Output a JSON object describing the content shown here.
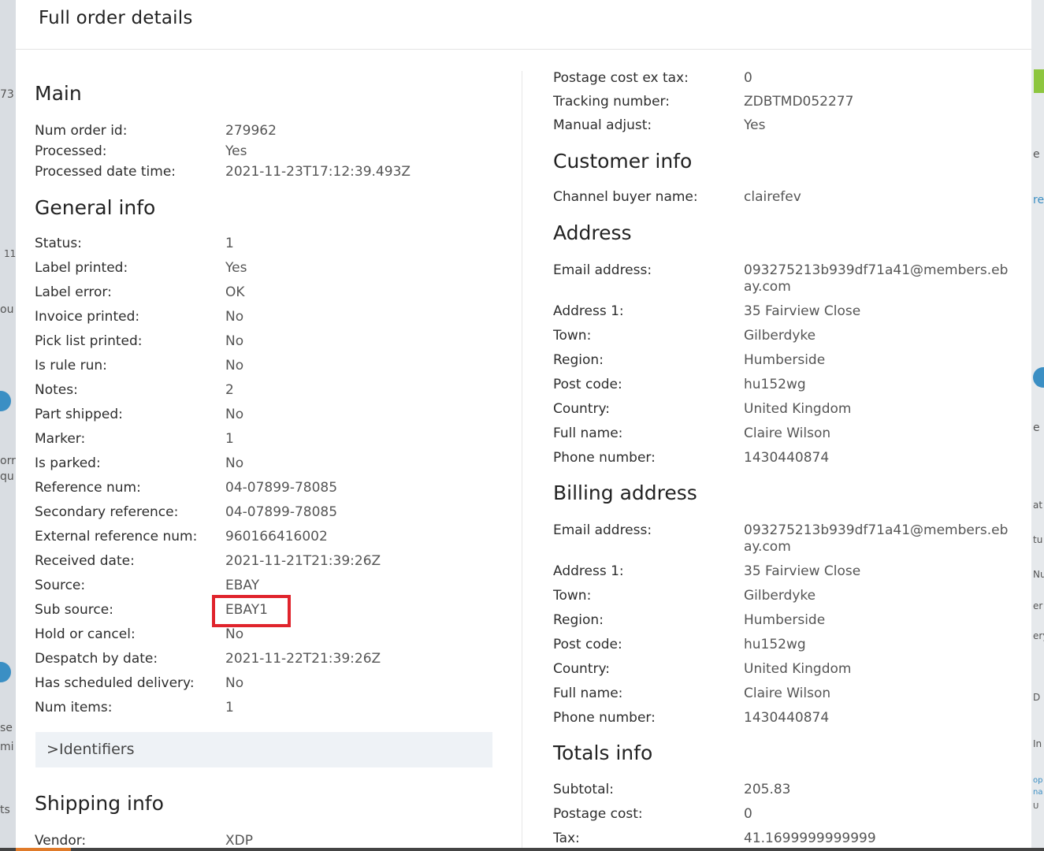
{
  "modal": {
    "title": "Full order details"
  },
  "left": {
    "main": {
      "heading": "Main",
      "rows": [
        {
          "label": "Num order id:",
          "value": "279962"
        },
        {
          "label": "Processed:",
          "value": "Yes"
        },
        {
          "label": "Processed date time:",
          "value": "2021-11-23T17:12:39.493Z"
        }
      ]
    },
    "general": {
      "heading": "General info",
      "rows": [
        {
          "label": "Status:",
          "value": "1"
        },
        {
          "label": "Label printed:",
          "value": "Yes"
        },
        {
          "label": "Label error:",
          "value": "OK"
        },
        {
          "label": "Invoice printed:",
          "value": "No"
        },
        {
          "label": "Pick list printed:",
          "value": "No"
        },
        {
          "label": "Is rule run:",
          "value": "No"
        },
        {
          "label": "Notes:",
          "value": "2"
        },
        {
          "label": "Part shipped:",
          "value": "No"
        },
        {
          "label": "Marker:",
          "value": "1"
        },
        {
          "label": "Is parked:",
          "value": "No"
        },
        {
          "label": "Reference num:",
          "value": "04-07899-78085"
        },
        {
          "label": "Secondary reference:",
          "value": "04-07899-78085"
        },
        {
          "label": "External reference num:",
          "value": "960166416002"
        },
        {
          "label": "Received date:",
          "value": "2021-11-21T21:39:26Z"
        },
        {
          "label": "Source:",
          "value": "EBAY"
        },
        {
          "label": "Sub source:",
          "value": "EBAY1"
        },
        {
          "label": "Hold or cancel:",
          "value": "No"
        },
        {
          "label": "Despatch by date:",
          "value": "2021-11-22T21:39:26Z"
        },
        {
          "label": "Has scheduled delivery:",
          "value": "No"
        },
        {
          "label": "Num items:",
          "value": "1"
        }
      ]
    },
    "identifiers": {
      "chevron": ">",
      "label": "Identifiers"
    },
    "shipping": {
      "heading": "Shipping info",
      "rows": [
        {
          "label": "Vendor:",
          "value": "XDP"
        }
      ]
    }
  },
  "right": {
    "shipping_cont": {
      "rows": [
        {
          "label": "Postage cost ex tax:",
          "value": "0"
        },
        {
          "label": "Tracking number:",
          "value": "ZDBTMD052277"
        },
        {
          "label": "Manual adjust:",
          "value": "Yes"
        }
      ]
    },
    "customer": {
      "heading": "Customer info",
      "rows": [
        {
          "label": "Channel buyer name:",
          "value": "clairefev"
        }
      ]
    },
    "address": {
      "heading": "Address",
      "rows": [
        {
          "label": "Email address:",
          "value": "093275213b939df71a41@members.ebay.com"
        },
        {
          "label": "Address 1:",
          "value": "35 Fairview Close"
        },
        {
          "label": "Town:",
          "value": "Gilberdyke"
        },
        {
          "label": "Region:",
          "value": "Humberside"
        },
        {
          "label": "Post code:",
          "value": "hu152wg"
        },
        {
          "label": "Country:",
          "value": "United Kingdom"
        },
        {
          "label": "Full name:",
          "value": "Claire Wilson"
        },
        {
          "label": "Phone number:",
          "value": "1430440874"
        }
      ]
    },
    "billing": {
      "heading": "Billing address",
      "rows": [
        {
          "label": "Email address:",
          "value": "093275213b939df71a41@members.ebay.com"
        },
        {
          "label": "Address 1:",
          "value": "35 Fairview Close"
        },
        {
          "label": "Town:",
          "value": "Gilberdyke"
        },
        {
          "label": "Region:",
          "value": "Humberside"
        },
        {
          "label": "Post code:",
          "value": "hu152wg"
        },
        {
          "label": "Country:",
          "value": "United Kingdom"
        },
        {
          "label": "Full name:",
          "value": "Claire Wilson"
        },
        {
          "label": "Phone number:",
          "value": "1430440874"
        }
      ]
    },
    "totals": {
      "heading": "Totals info",
      "rows": [
        {
          "label": "Subtotal:",
          "value": "205.83"
        },
        {
          "label": "Postage cost:",
          "value": "0"
        },
        {
          "label": "Tax:",
          "value": "41.1699999999999"
        }
      ]
    }
  },
  "background": {
    "left_fragments": [
      "73",
      "11",
      "ou",
      "orr",
      "qu",
      "se",
      "mi",
      "ts"
    ],
    "right_fragments": [
      "e",
      "re",
      "e",
      "at",
      "tu",
      "Nu",
      "er",
      "ery",
      "D",
      "In",
      "op",
      "na",
      "U"
    ]
  }
}
